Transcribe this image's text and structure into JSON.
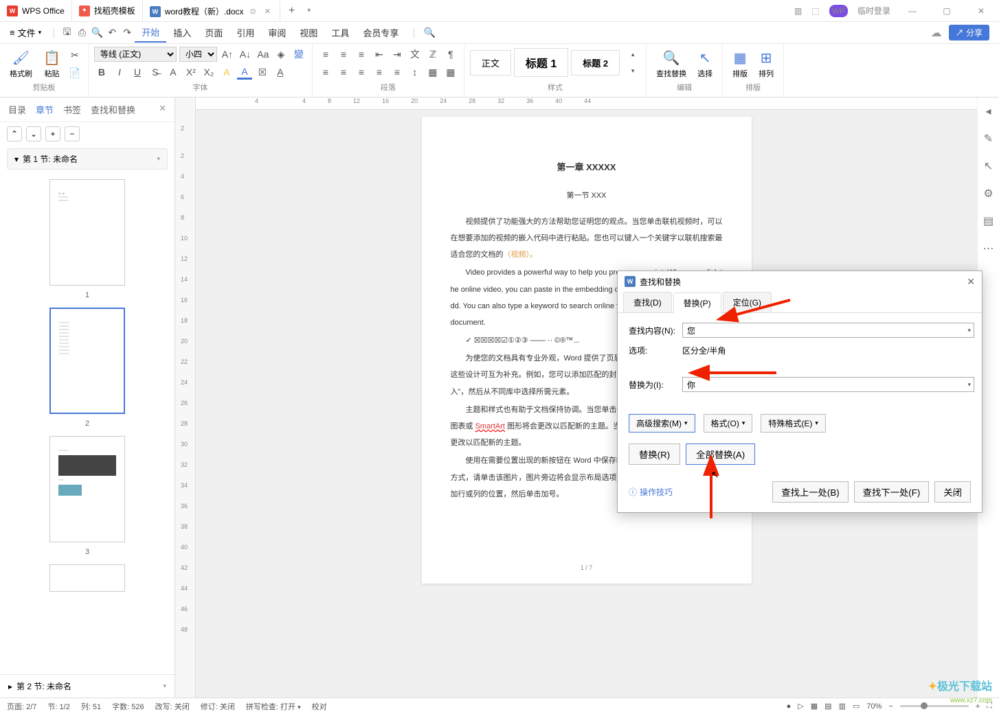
{
  "titlebar": {
    "tabs": [
      {
        "label": "WPS Office",
        "icon": "wps"
      },
      {
        "label": "找稻壳模板",
        "icon": "template"
      },
      {
        "label": "word教程（新）.docx",
        "icon": "doc",
        "active": true,
        "closable": true
      }
    ],
    "dropdown_icon": "▾",
    "user_badge": "WP",
    "login_label": "临时登录"
  },
  "menubar": {
    "file_label": "文件",
    "items": [
      "开始",
      "插入",
      "页面",
      "引用",
      "审阅",
      "视图",
      "工具",
      "会员专享"
    ],
    "active_index": 0,
    "share_label": "分享"
  },
  "ribbon": {
    "clipboard": {
      "format_brush": "格式刷",
      "paste": "粘贴",
      "group_label": "剪贴板"
    },
    "font": {
      "font_name": "等线 (正文)",
      "font_size": "小四",
      "group_label": "字体"
    },
    "paragraph": {
      "group_label": "段落"
    },
    "styles": {
      "items": [
        "正文",
        "标题 1",
        "标题 2"
      ],
      "group_label": "样式"
    },
    "find_replace": "查找替换",
    "select": "选择",
    "sort": "排版",
    "arrange": "排列",
    "arrange_group": "排版"
  },
  "nav_panel": {
    "tabs": [
      "目录",
      "章节",
      "书签",
      "查找和替换"
    ],
    "active_index": 1,
    "section1": "第 1 节: 未命名",
    "section2": "第 2 节: 未命名",
    "thumb_labels": [
      "1",
      "2",
      "3"
    ],
    "selected_thumb": 1
  },
  "h_ruler": [
    "4",
    "",
    "4",
    "8",
    "12",
    "16",
    "20",
    "24",
    "28",
    "32",
    "36",
    "40",
    "44"
  ],
  "v_ruler": [
    "2",
    "",
    "2",
    "4",
    "6",
    "8",
    "10",
    "12",
    "14",
    "16",
    "18",
    "20",
    "22",
    "24",
    "26",
    "28",
    "30",
    "32",
    "34",
    "36",
    "38",
    "40",
    "42",
    "44",
    "46",
    "48"
  ],
  "document": {
    "chapter_title": "第一章  XXXXX",
    "section_title": "第一节  XXX",
    "p1": "视频提供了功能强大的方法帮助您证明您的观点。当您单击联机视频时，可以在想要添加的视频的嵌入代码中进行粘贴。您也可以键入一个关键字以联机搜索最适合您的文档的",
    "p1_red": "（视频）。",
    "p2": "Video provides a powerful way to help you prove your point. When you click the online video, you can paste in the embedding code for the video you want to add. You can also type a keyword to search online for the video that best fits your document.",
    "p3": "✓ ☒☒☒☒☑①②③ —— ·· ©®™...",
    "p4": "为使您的文档具有专业外观，Word 提供了页眉、页脚、封面和文本框设计，这些设计可互为补充。例如，您可以添加匹配的封面、页眉和提要栏。单击\"插入\"，然后从不同库中选择所需元素。",
    "p5_a": "主题和样式也有助于文档保持协调。当您单击设计并选择新的主题时，图片、图表或 ",
    "p5_smart": "SmartArt",
    "p5_b": " 图形将会更改以匹配新的主题。当应用样式时，您的标题会进行更改以匹配新的主题。",
    "p6": "使用在需要位置出现的新按钮在 Word 中保存时间。若要更改图片适应文档的方式，请单击该图片，图片旁边将会显示布局选项按钮。当处理表格时，单击要添加行或列的位置，然后单击加号。",
    "page_num": "1 / 7"
  },
  "dialog": {
    "title": "查找和替换",
    "tabs": [
      "查找(D)",
      "替换(P)",
      "定位(G)"
    ],
    "active_tab": 1,
    "find_label": "查找内容(N):",
    "find_value": "您",
    "options_label": "选项:",
    "options_value": "区分全/半角",
    "replace_label": "替换为(I):",
    "replace_value": "你",
    "advanced_btn": "高级搜索(M)",
    "format_btn": "格式(O)",
    "special_btn": "特殊格式(E)",
    "replace_btn": "替换(R)",
    "replace_all_btn": "全部替换(A)",
    "tip_label": "操作技巧",
    "find_prev_btn": "查找上一处(B)",
    "find_next_btn": "查找下一处(F)",
    "close_btn": "关闭"
  },
  "statusbar": {
    "page": "页面: 2/7",
    "section": "节: 1/2",
    "col": "列: 51",
    "words": "字数: 526",
    "revisions": "改写: 关闭",
    "track": "修订: 关闭",
    "spell": "拼写检查: 打开",
    "proof": "校对",
    "zoom": "70%"
  },
  "watermark": {
    "main": "极光下载站",
    "sub": "www.xz7.com"
  }
}
